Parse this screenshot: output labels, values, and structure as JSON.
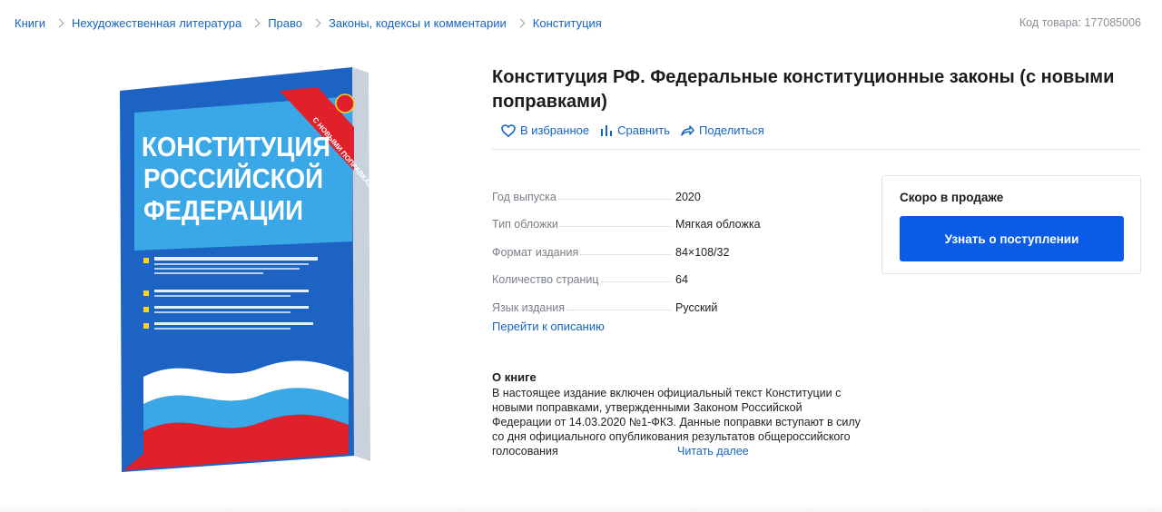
{
  "breadcrumbs": {
    "items": [
      "Книги",
      "Нехудожественная литература",
      "Право",
      "Законы, кодексы и комментарии",
      "Конституция"
    ]
  },
  "sku": "Код товара: 177085006",
  "cover": {
    "title_lines": [
      "КОНСТИТУЦИЯ",
      "РОССИЙСКОЙ",
      "ФЕДЕРАЦИИ"
    ],
    "ribbon": "С НОВЫМИ ПОПРАВКАМИ 2020",
    "colors": {
      "blue": "#1d63c4",
      "light_blue": "#3aa8e6",
      "red": "#e0202a",
      "yellow": "#ffd21f"
    }
  },
  "product": {
    "title": "Конституция РФ. Федеральные конституционные законы (с новыми поправками)"
  },
  "actions": {
    "favorite": "В избранное",
    "compare": "Сравнить",
    "share": "Поделиться"
  },
  "specs": [
    {
      "label": "Год выпуска",
      "value": "2020"
    },
    {
      "label": "Тип обложки",
      "value": "Мягкая обложка"
    },
    {
      "label": "Формат издания",
      "value": "84×108/32"
    },
    {
      "label": "Количество страниц",
      "value": "64"
    },
    {
      "label": "Язык издания",
      "value": "Русский"
    }
  ],
  "go_to_description": "Перейти к описанию",
  "about": {
    "title": "О книге",
    "text": "В настоящее издание включен официальный текст Конституции с новыми поправками, утвержденными Законом Российской Федерации от 14.03.2020 №1-ФКЗ. Данные поправки вступают в силу со дня официального опубликования результатов общероссийского голосования",
    "read_more": "Читать далее"
  },
  "buybox": {
    "title": "Скоро в продаже",
    "button": "Узнать о поступлении"
  },
  "theme": {
    "link_color": "#1565c0",
    "button_color": "#0a5ce6"
  }
}
